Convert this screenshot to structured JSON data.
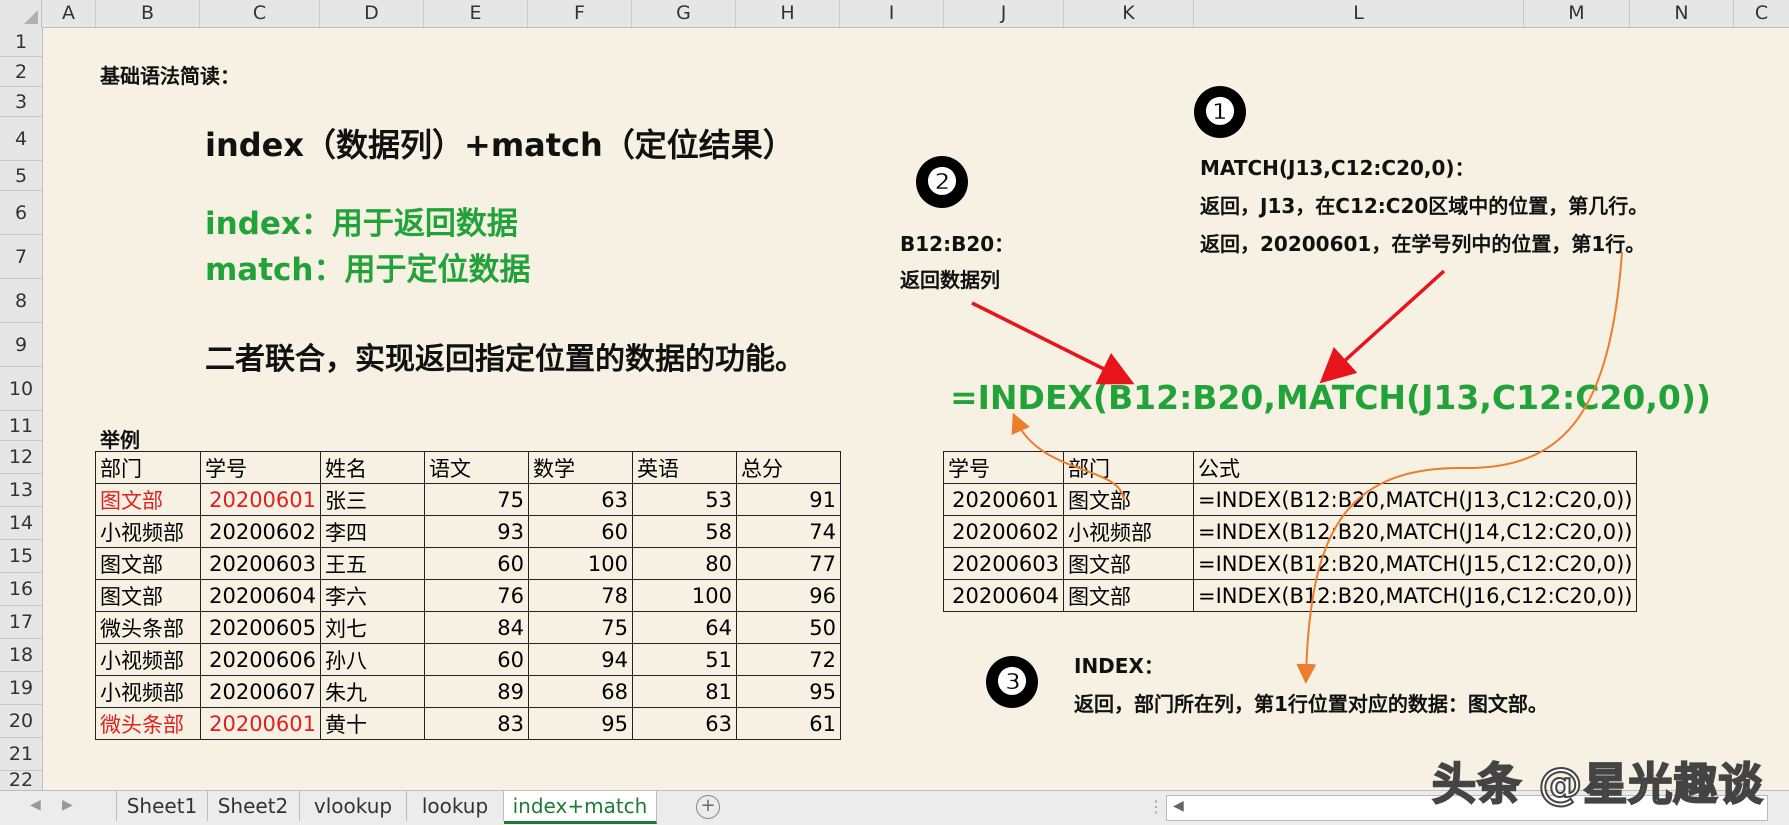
{
  "columns": [
    "A",
    "B",
    "C",
    "D",
    "E",
    "F",
    "G",
    "H",
    "I",
    "J",
    "K",
    "L",
    "M",
    "N",
    "C"
  ],
  "rows": [
    "1",
    "2",
    "3",
    "4",
    "5",
    "6",
    "7",
    "8",
    "9",
    "10",
    "11",
    "12",
    "13",
    "14",
    "15",
    "16",
    "17",
    "18",
    "19",
    "20",
    "21",
    "22"
  ],
  "heading": "基础语法简读：",
  "syntax_line": "index（数据列）+match（定位结果）",
  "index_desc": "index：用于返回数据",
  "match_desc": "match：用于定位数据",
  "combine_desc": "二者联合，实现返回指定位置的数据的功能。",
  "example_label": "举例",
  "main_table": {
    "headers": [
      "部门",
      "学号",
      "姓名",
      "语文",
      "数学",
      "英语",
      "总分"
    ],
    "rows": [
      [
        "图文部",
        "20200601",
        "张三",
        "75",
        "63",
        "53",
        "91"
      ],
      [
        "小视频部",
        "20200602",
        "李四",
        "93",
        "60",
        "58",
        "74"
      ],
      [
        "图文部",
        "20200603",
        "王五",
        "60",
        "100",
        "80",
        "77"
      ],
      [
        "图文部",
        "20200604",
        "李六",
        "76",
        "78",
        "100",
        "96"
      ],
      [
        "微头条部",
        "20200605",
        "刘七",
        "84",
        "75",
        "64",
        "50"
      ],
      [
        "小视频部",
        "20200606",
        "孙八",
        "60",
        "94",
        "51",
        "72"
      ],
      [
        "小视频部",
        "20200607",
        "朱九",
        "89",
        "68",
        "81",
        "95"
      ],
      [
        "微头条部",
        "20200601",
        "黄十",
        "83",
        "95",
        "63",
        "61"
      ]
    ]
  },
  "formula_big": "=INDEX(B12:B20,MATCH(J13,C12:C20,0))",
  "lookup_table": {
    "headers": [
      "学号",
      "部门",
      "公式"
    ],
    "rows": [
      [
        "20200601",
        "图文部",
        "=INDEX(B12:B20,MATCH(J13,C12:C20,0))"
      ],
      [
        "20200602",
        "小视频部",
        "=INDEX(B12:B20,MATCH(J14,C12:C20,0))"
      ],
      [
        "20200603",
        "图文部",
        "=INDEX(B12:B20,MATCH(J15,C12:C20,0))"
      ],
      [
        "20200604",
        "图文部",
        "=INDEX(B12:B20,MATCH(J16,C12:C20,0))"
      ]
    ]
  },
  "annotation1": {
    "number": "❶",
    "line1": "MATCH(J13,C12:C20,0)：",
    "line2": "返回，J13，在C12:C20区域中的位置，第几行。",
    "line3": "返回，20200601，在学号列中的位置，第1行。"
  },
  "annotation2": {
    "number": "❷",
    "line1": "B12:B20：",
    "line2": "返回数据列"
  },
  "annotation3": {
    "number": "❸",
    "line1": "INDEX：",
    "line2": "返回，部门所在列，第1行位置对应的数据：图文部。"
  },
  "sheet_tabs": [
    "Sheet1",
    "Sheet2",
    "vlookup",
    "lookup",
    "index+match"
  ],
  "active_tab": "index+match",
  "watermark": "头条 @星光趣谈",
  "colors": {
    "green": "#21a33a",
    "red": "#e02020",
    "arrow_red": "#e8141c",
    "arrow_orange": "#ec7d2c",
    "active_tab": "#1e7b34"
  }
}
